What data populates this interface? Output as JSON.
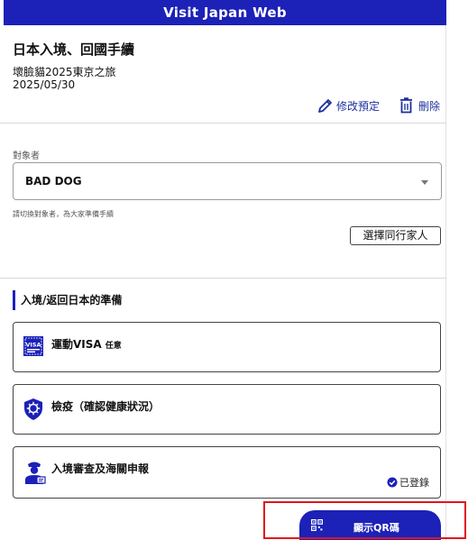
{
  "header": {
    "title": "Visit Japan Web"
  },
  "procedure": {
    "title": "日本入境、回國手續",
    "trip_name": "壞臉貓2025東京之旅",
    "trip_date": "2025/05/30"
  },
  "actions": {
    "edit_label": "修改預定",
    "delete_label": "刪除"
  },
  "target": {
    "label": "對象者",
    "selected": "BAD DOG",
    "helper": "請切換對象者，為大家準備手續",
    "companion_button": "選擇同行家人"
  },
  "preparation": {
    "heading": "入境/返回日本的準備",
    "cards": [
      {
        "title": "運動VISA",
        "sub": "任意",
        "icon": "visa-icon"
      },
      {
        "title": "檢疫（確認健康狀況）",
        "icon": "quarantine-shield-icon"
      },
      {
        "title": "入境審查及海關申報",
        "status": "已登錄",
        "icon": "immigration-officer-icon"
      }
    ]
  },
  "qr": {
    "label": "顯示QR碼",
    "icon": "qr-code-icon"
  },
  "colors": {
    "brand": "#1c21b8",
    "link": "#1c2fa0",
    "highlight": "#e0151b"
  }
}
